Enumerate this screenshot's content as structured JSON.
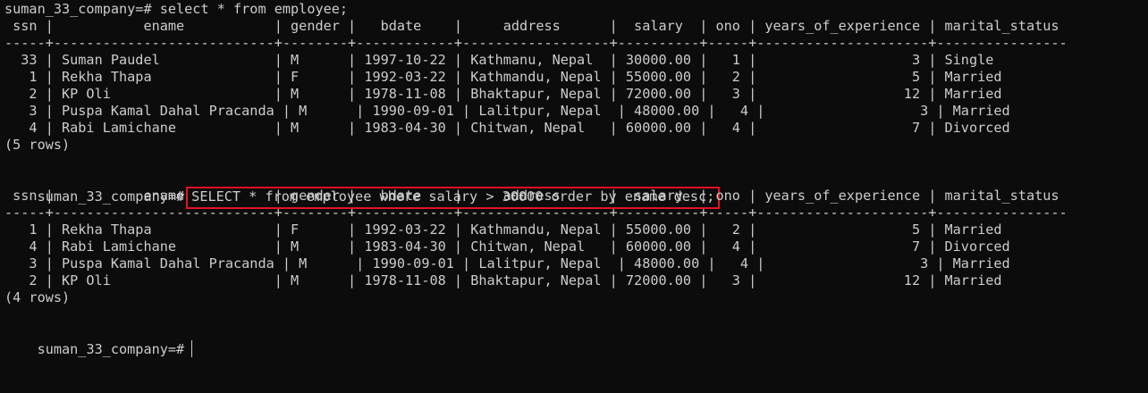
{
  "terminal": {
    "prompt": "suman_33_company=#",
    "lines": [
      "suman_33_company=# select * from employee;",
      " ssn |           ename           | gender |   bdate    |     address      |  salary  | ono | years_of_experience | marital_status",
      "-----+---------------------------+--------+------------+------------------+----------+-----+---------------------+----------------",
      "  33 | Suman Paudel              | M      | 1997-10-22 | Kathmanu, Nepal  | 30000.00 |   1 |                   3 | Single",
      "   1 | Rekha Thapa               | F      | 1992-03-22 | Kathmandu, Nepal | 55000.00 |   2 |                   5 | Married",
      "   2 | KP Oli                    | M      | 1978-11-08 | Bhaktapur, Nepal | 72000.00 |   3 |                  12 | Married",
      "   3 | Puspa Kamal Dahal Pracanda | M      | 1990-09-01 | Lalitpur, Nepal  | 48000.00 |   4 |                   3 | Married",
      "   4 | Rabi Lamichane            | M      | 1983-04-30 | Chitwan, Nepal   | 60000.00 |   4 |                   7 | Divorced",
      "(5 rows)",
      "",
      "",
      " ssn |           ename           | gender |   bdate    |     address      |  salary  | ono | years_of_experience | marital_status",
      "-----+---------------------------+--------+------------+------------------+----------+-----+---------------------+----------------",
      "   1 | Rekha Thapa               | F      | 1992-03-22 | Kathmandu, Nepal | 55000.00 |   2 |                   5 | Married",
      "   4 | Rabi Lamichane            | M      | 1983-04-30 | Chitwan, Nepal   | 60000.00 |   4 |                   7 | Divorced",
      "   3 | Puspa Kamal Dahal Pracanda | M      | 1990-09-01 | Lalitpur, Nepal  | 48000.00 |   4 |                   3 | Married",
      "   2 | KP Oli                    | M      | 1978-11-08 | Bhaktapur, Nepal | 72000.00 |   3 |                  12 | Married",
      "(4 rows)"
    ],
    "highlighted_command": "SELECT * from employee where salary > 30000 order by ename desc;"
  }
}
